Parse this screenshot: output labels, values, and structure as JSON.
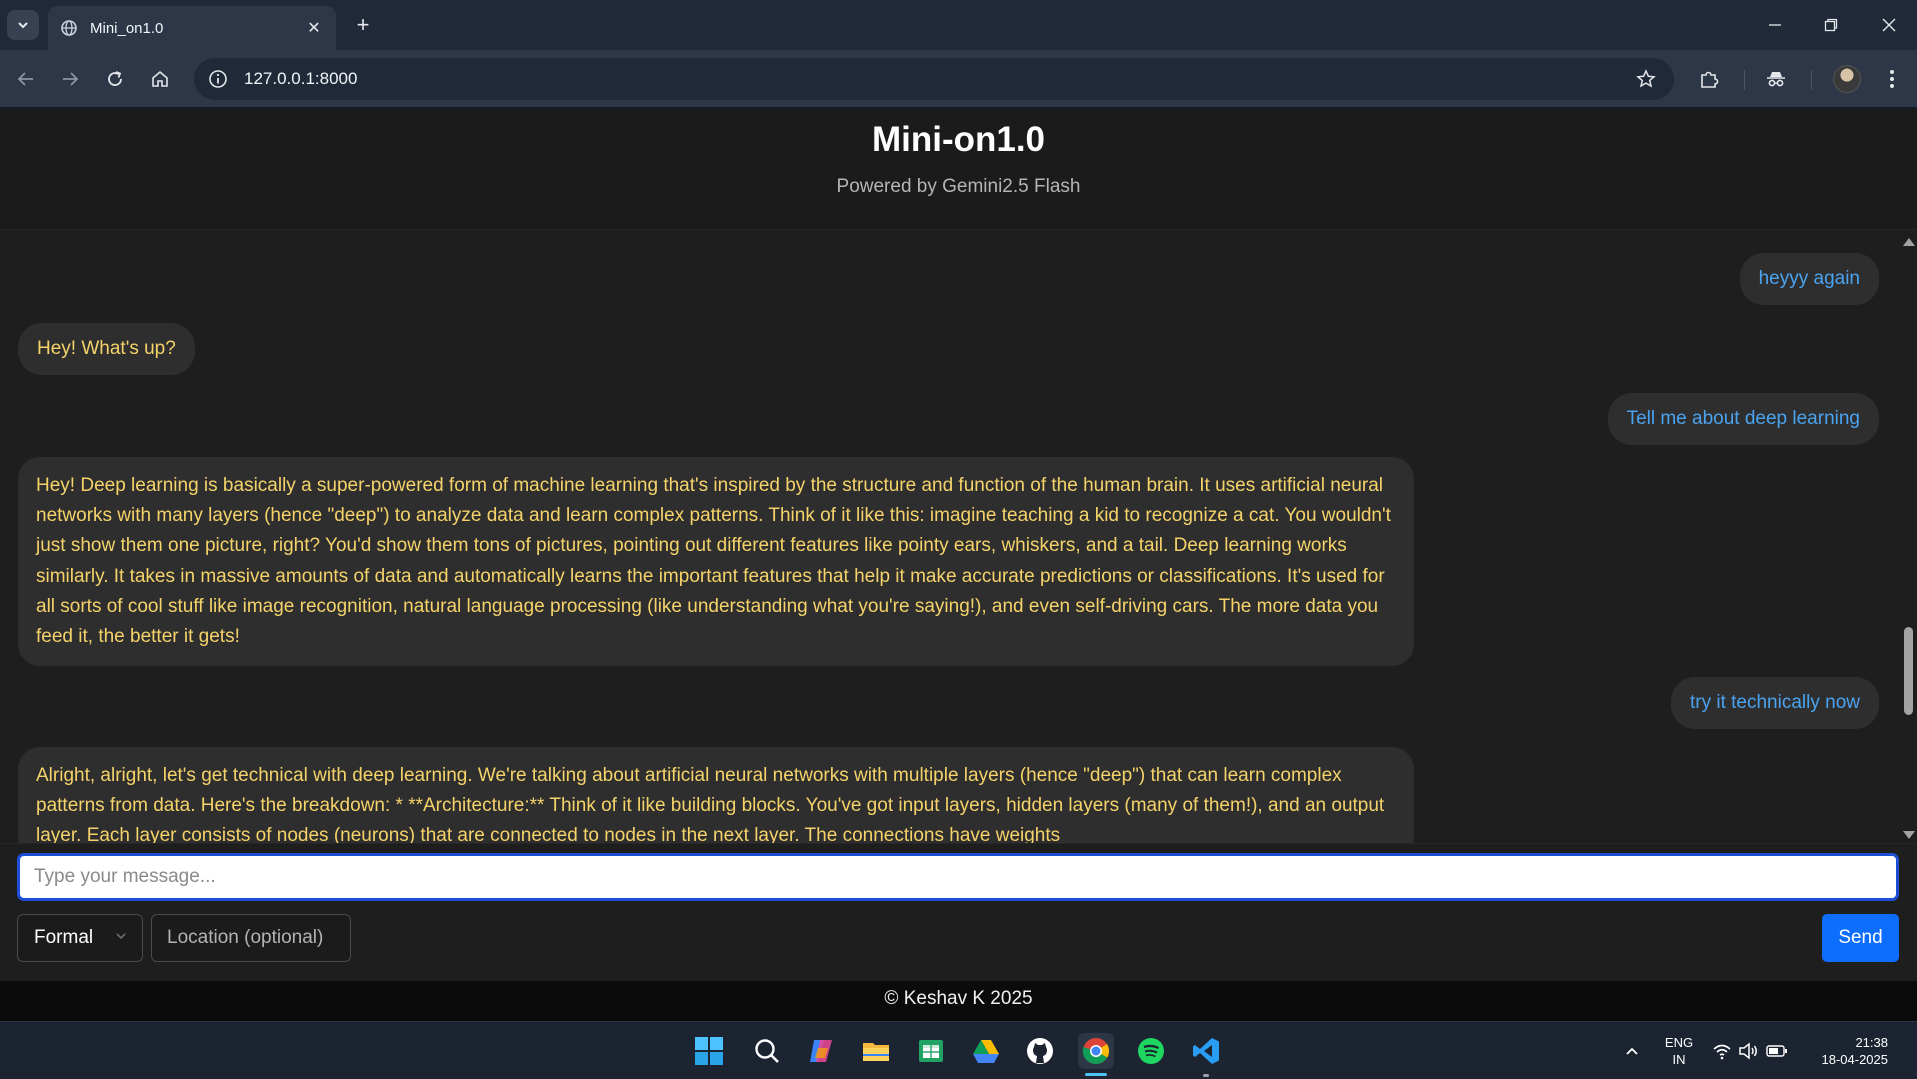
{
  "browser": {
    "tab_title": "Mini_on1.0",
    "url": "127.0.0.1:8000"
  },
  "app": {
    "title": "Mini-on1.0",
    "subtitle": "Powered by Gemini2.5 Flash"
  },
  "messages": [
    {
      "role": "user",
      "text": "heyyy again"
    },
    {
      "role": "bot",
      "text": "Hey! What's up?"
    },
    {
      "role": "user",
      "text": "Tell me about deep learning"
    },
    {
      "role": "bot",
      "text": "Hey! Deep learning is basically a super-powered form of machine learning that's inspired by the structure and function of the human brain. It uses artificial neural networks with many layers (hence \"deep\") to analyze data and learn complex patterns. Think of it like this: imagine teaching a kid to recognize a cat. You wouldn't just show them one picture, right? You'd show them tons of pictures, pointing out different features like pointy ears, whiskers, and a tail. Deep learning works similarly. It takes in massive amounts of data and automatically learns the important features that help it make accurate predictions or classifications. It's used for all sorts of cool stuff like image recognition, natural language processing (like understanding what you're saying!), and even self-driving cars. The more data you feed it, the better it gets!"
    },
    {
      "role": "user",
      "text": "try it technically now"
    },
    {
      "role": "bot",
      "text": "Alright, alright, let's get technical with deep learning. We're talking about artificial neural networks with multiple layers (hence \"deep\") that can learn complex patterns from data. Here's the breakdown: * **Architecture:** Think of it like building blocks. You've got input layers, hidden layers (many of them!), and an output layer. Each layer consists of nodes (neurons) that are connected to nodes in the next layer. The connections have weights"
    }
  ],
  "composer": {
    "message_placeholder": "Type your message...",
    "tone_selected": "Formal",
    "location_placeholder": "Location (optional)",
    "send_label": "Send"
  },
  "footer": {
    "text": "© Keshav K 2025"
  },
  "taskbar": {
    "lang_line1": "ENG",
    "lang_line2": "IN",
    "time": "21:38",
    "date": "18-04-2025"
  },
  "colors": {
    "user_text": "#4aa3f0",
    "bot_text": "#f5d36a",
    "send_button": "#0d6efd"
  }
}
